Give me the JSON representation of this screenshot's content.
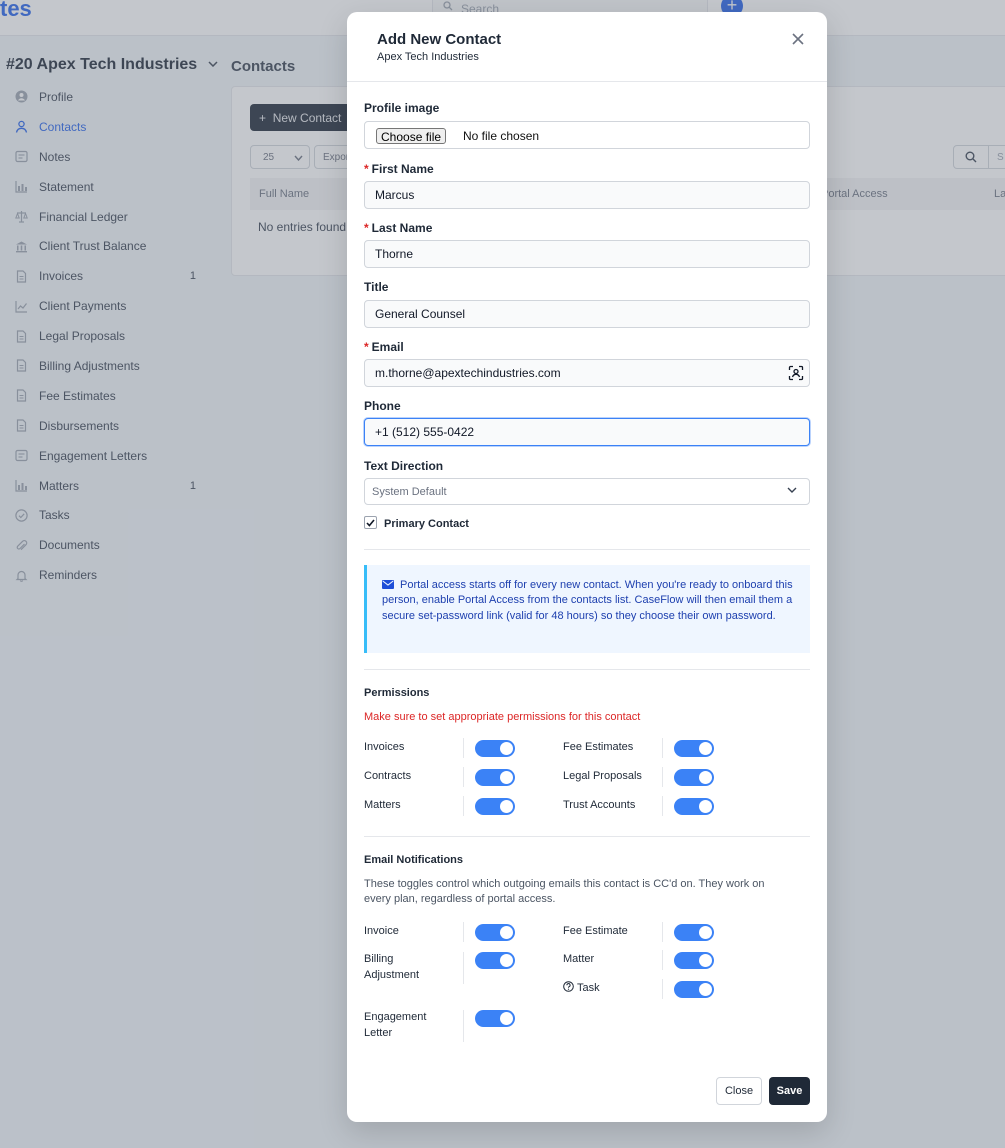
{
  "app": {
    "brand_fragment": "tes",
    "search_placeholder": "Search",
    "client_title": "#20 Apex Tech Industries",
    "page_heading": "Contacts"
  },
  "sidebar": {
    "items": [
      {
        "label": "Profile",
        "icon": "user-circle-icon",
        "count": "",
        "active": false
      },
      {
        "label": "Contacts",
        "icon": "user-icon",
        "count": "",
        "active": true
      },
      {
        "label": "Notes",
        "icon": "note-icon",
        "count": "",
        "active": false
      },
      {
        "label": "Statement",
        "icon": "chart-icon",
        "count": "",
        "active": false
      },
      {
        "label": "Financial Ledger",
        "icon": "scale-icon",
        "count": "",
        "active": false
      },
      {
        "label": "Client Trust Balance",
        "icon": "bank-icon",
        "count": "",
        "active": false
      },
      {
        "label": "Invoices",
        "icon": "file-icon",
        "count": "1",
        "active": false
      },
      {
        "label": "Client Payments",
        "icon": "trend-icon",
        "count": "",
        "active": false
      },
      {
        "label": "Legal Proposals",
        "icon": "file-icon",
        "count": "",
        "active": false
      },
      {
        "label": "Billing Adjustments",
        "icon": "file-icon",
        "count": "",
        "active": false
      },
      {
        "label": "Fee Estimates",
        "icon": "file-icon",
        "count": "",
        "active": false
      },
      {
        "label": "Disbursements",
        "icon": "file-icon",
        "count": "",
        "active": false
      },
      {
        "label": "Engagement Letters",
        "icon": "note-icon",
        "count": "",
        "active": false
      },
      {
        "label": "Matters",
        "icon": "chart-icon",
        "count": "1",
        "active": false
      },
      {
        "label": "Tasks",
        "icon": "check-circle-icon",
        "count": "",
        "active": false
      },
      {
        "label": "Documents",
        "icon": "paperclip-icon",
        "count": "",
        "active": false
      },
      {
        "label": "Reminders",
        "icon": "bell-icon",
        "count": "",
        "active": false
      }
    ]
  },
  "contacts_panel": {
    "new_contact_label": "New Contact",
    "page_length": "25",
    "export_label": "Export",
    "columns": [
      "Full Name",
      "Portal Access",
      "La"
    ],
    "empty_text": "No entries found",
    "search_placeholder": "S"
  },
  "modal": {
    "title": "Add New Contact",
    "subtitle": "Apex Tech Industries",
    "profile_image_label": "Profile image",
    "file_button": "Choose file",
    "file_status": "No file chosen",
    "first_name_label": "First Name",
    "first_name_value": "Marcus",
    "last_name_label": "Last Name",
    "last_name_value": "Thorne",
    "title_label": "Title",
    "title_value": "General Counsel",
    "email_label": "Email",
    "email_value": "m.thorne@apextechindustries.com",
    "phone_label": "Phone",
    "phone_value": "+1 (512) 555-0422",
    "text_direction_label": "Text Direction",
    "text_direction_value": "System Default",
    "primary_contact_label": "Primary Contact",
    "primary_contact_checked": true,
    "info_text": "Portal access starts off for every new contact. When you're ready to onboard this person, enable Portal Access from the contacts list. CaseFlow will then email them a secure set-password link (valid for 48 hours) so they choose their own password.",
    "permissions_title": "Permissions",
    "permissions_warning": "Make sure to set appropriate permissions for this contact",
    "permissions": [
      {
        "label": "Invoices",
        "on": true
      },
      {
        "label": "Fee Estimates",
        "on": true
      },
      {
        "label": "Contracts",
        "on": true
      },
      {
        "label": "Legal Proposals",
        "on": true
      },
      {
        "label": "Matters",
        "on": true
      },
      {
        "label": "Trust Accounts",
        "on": true
      }
    ],
    "notifications_title": "Email Notifications",
    "notifications_help": "These toggles control which outgoing emails this contact is CC'd on. They work on every plan, regardless of portal access.",
    "notifications": [
      {
        "label": "Invoice",
        "on": true
      },
      {
        "label": "Fee Estimate",
        "on": true
      },
      {
        "label": "Billing Adjustment",
        "on": true
      },
      {
        "label": "Matter",
        "on": true
      },
      {
        "label": "Task",
        "on": true
      },
      {
        "label": "Engagement Letter",
        "on": true
      }
    ],
    "close_label": "Close",
    "save_label": "Save"
  },
  "colors": {
    "accent": "#3b82f6",
    "brand": "#2563eb",
    "required": "#dc2626",
    "info_bg": "#eff6ff",
    "info_text": "#1e40af",
    "dark_button": "#1f2937"
  }
}
